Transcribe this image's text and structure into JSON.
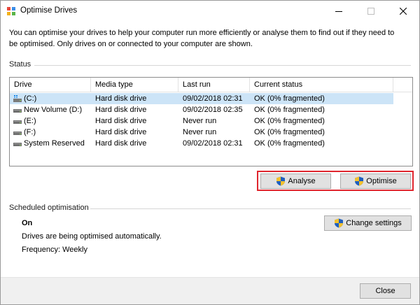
{
  "window": {
    "title": "Optimise Drives"
  },
  "intro": {
    "text": "You can optimise your drives to help your computer run more efficiently or analyse them to find out if they need to be optimised. Only drives on or connected to your computer are shown."
  },
  "status": {
    "label": "Status",
    "columns": [
      "Drive",
      "Media type",
      "Last run",
      "Current status"
    ],
    "drives": [
      {
        "drive": "(C:)",
        "media": "Hard disk drive",
        "last_run": "09/02/2018 02:31",
        "status": "OK (0% fragmented)",
        "icon": "windows-drive-icon",
        "selected": true
      },
      {
        "drive": "New Volume (D:)",
        "media": "Hard disk drive",
        "last_run": "09/02/2018 02:35",
        "status": "OK (0% fragmented)",
        "icon": "drive-icon",
        "selected": false
      },
      {
        "drive": "(E:)",
        "media": "Hard disk drive",
        "last_run": "Never run",
        "status": "OK (0% fragmented)",
        "icon": "drive-icon",
        "selected": false
      },
      {
        "drive": "(F:)",
        "media": "Hard disk drive",
        "last_run": "Never run",
        "status": "OK (0% fragmented)",
        "icon": "drive-icon",
        "selected": false
      },
      {
        "drive": "System Reserved",
        "media": "Hard disk drive",
        "last_run": "09/02/2018 02:31",
        "status": "OK (0% fragmented)",
        "icon": "drive-icon",
        "selected": false
      }
    ]
  },
  "actions": {
    "analyse_label": "Analyse",
    "optimise_label": "Optimise",
    "highlight_color": "#e0262e"
  },
  "scheduled": {
    "label": "Scheduled optimisation",
    "state": "On",
    "description": "Drives are being optimised automatically.",
    "frequency": "Frequency: Weekly",
    "change_label": "Change settings"
  },
  "footer": {
    "close_label": "Close"
  },
  "colors": {
    "selection": "#cce4f7",
    "button_bg": "#e1e1e1",
    "footer_bg": "#f0f0f0"
  }
}
